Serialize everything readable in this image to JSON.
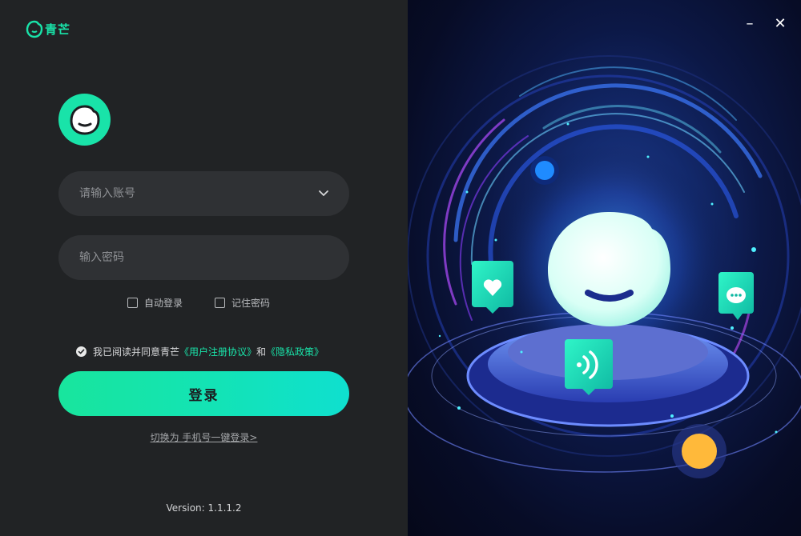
{
  "brand": {
    "name": "青芒"
  },
  "account": {
    "placeholder": "请输入账号"
  },
  "password": {
    "placeholder": "输入密码"
  },
  "options": {
    "auto_login": "自动登录",
    "remember_password": "记住密码"
  },
  "agreement": {
    "prefix": "我已阅读并同意青芒",
    "user_agreement": "《用户注册协议》",
    "conjunction": "和",
    "privacy_policy": "《隐私政策》"
  },
  "login_button": "登录",
  "switch_link": "切换为 手机号一键登录>",
  "version": "Version: 1.1.1.2",
  "window": {
    "minimize": "–",
    "close": "✕"
  },
  "colors": {
    "accent": "#19e3a9",
    "panel": "#212325",
    "field": "#2f3134"
  }
}
